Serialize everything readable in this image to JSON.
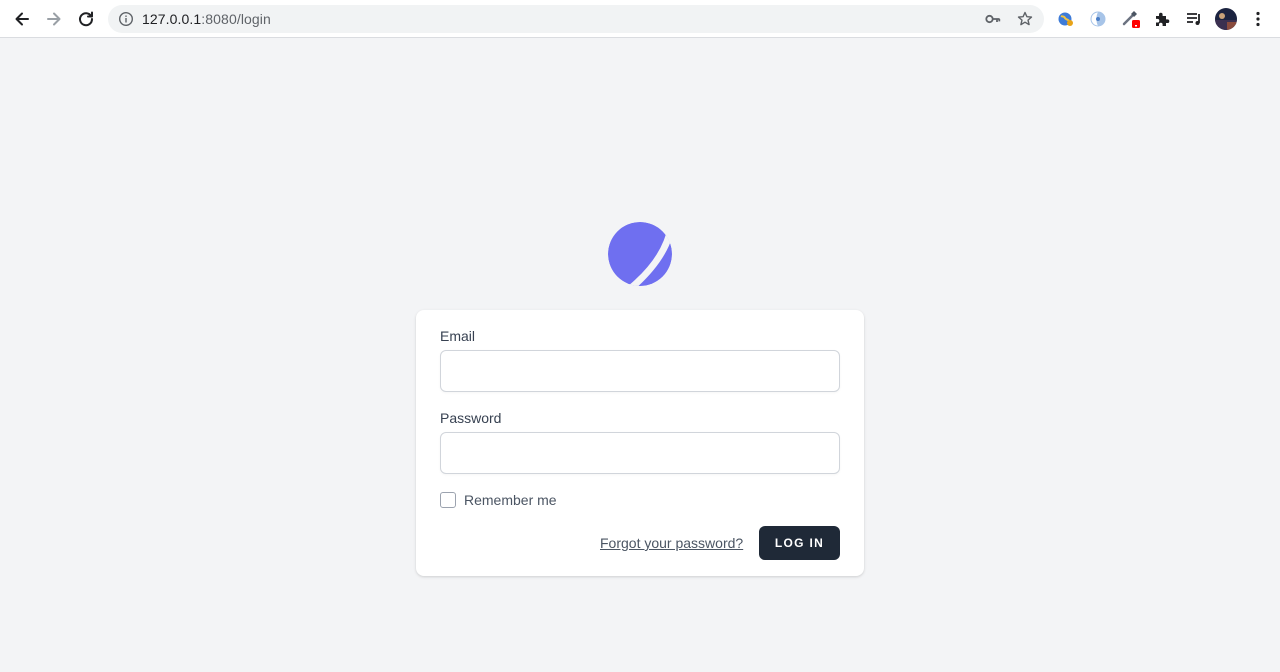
{
  "browser": {
    "url_host": "127.0.0.1",
    "url_rest": ":8080/login",
    "icons": [
      "back-icon",
      "forward-icon",
      "reload-icon",
      "info-icon",
      "key-icon",
      "star-icon",
      "puzzle-icon",
      "reading-list-icon",
      "more-icon"
    ],
    "colors": {
      "toolbar": "#ffffff",
      "omnibox": "#f1f3f4",
      "ext_badge": "#ff0000"
    }
  },
  "page": {
    "logo": "logo-icon",
    "accent": "#6f6ff0",
    "background": "#f3f4f6"
  },
  "form": {
    "email_label": "Email",
    "email_value": "",
    "password_label": "Password",
    "password_value": "",
    "remember_label": "Remember me",
    "remember_checked": false,
    "forgot_link": "Forgot your password?",
    "submit_label": "LOG IN",
    "submit_color": "#1f2937"
  }
}
